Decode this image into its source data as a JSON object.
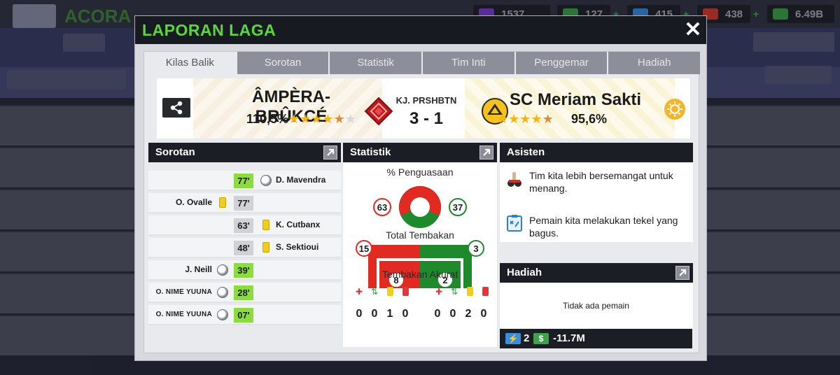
{
  "background": {
    "club_name": "ACORA",
    "resources": [
      {
        "name": "tokens",
        "value": "1537"
      },
      {
        "name": "cash-small",
        "value": "127"
      },
      {
        "name": "energy",
        "value": "415"
      },
      {
        "name": "medical",
        "value": "438"
      },
      {
        "name": "money",
        "value": "6.49B"
      }
    ]
  },
  "modal": {
    "title": "LAPORAN LAGA",
    "close_label": "✕"
  },
  "tabs": [
    "Kilas Balik",
    "Sorotan",
    "Statistik",
    "Tim Inti",
    "Penggemar",
    "Hadiah"
  ],
  "match": {
    "home": {
      "name": "ÂMPÈRA-BRÛKCÉ",
      "rating": "110,5%"
    },
    "away": {
      "name": "SC Meriam Sakti",
      "rating": "95,6%"
    },
    "competition": "KJ. PRSHBTN",
    "score": "3 - 1"
  },
  "highlights": {
    "title": "Sorotan",
    "events": [
      {
        "minute": "77'",
        "type": "goal",
        "side": "right",
        "player": "D. Mavendra"
      },
      {
        "minute": "77'",
        "type": "card",
        "side": "left",
        "player": "O. Ovalle"
      },
      {
        "minute": "63'",
        "type": "card",
        "side": "right",
        "player": "K. Cutbanx"
      },
      {
        "minute": "48'",
        "type": "card",
        "side": "right",
        "player": "S. Sektioui"
      },
      {
        "minute": "39'",
        "type": "goal",
        "side": "left",
        "player": "J. Neill"
      },
      {
        "minute": "28'",
        "type": "goal",
        "side": "left",
        "player": "O. NIME YUUNA"
      },
      {
        "minute": "07'",
        "type": "goal",
        "side": "left",
        "player": "O. NIME YUUNA"
      }
    ]
  },
  "stats": {
    "title": "Statistik",
    "possession_label": "% Penguasaan",
    "possession_home": 63,
    "possession_away": 37,
    "shots_label": "Total Tembakan",
    "shots_home": 15,
    "shots_away": 3,
    "on_target_label": "Tembakan Akurat",
    "on_target_home": 8,
    "on_target_away": 2,
    "discipline_icons": [
      "injury-icon",
      "substitution-icon",
      "yellow-card-icon",
      "red-card-icon"
    ],
    "discipline_home": [
      "0",
      "0",
      "1",
      "0"
    ],
    "discipline_away": [
      "0",
      "0",
      "2",
      "0"
    ],
    "colors": {
      "home": "#e02a22",
      "away": "#1e8a2b"
    }
  },
  "assistant": {
    "title": "Asisten",
    "items": [
      {
        "icon": "motivation-icon",
        "text": "Tim kita lebih bersemangat untuk menang."
      },
      {
        "icon": "tactics-board-icon",
        "text": "Pemain kita melakukan tekel yang bagus."
      }
    ]
  },
  "rewards": {
    "title": "Hadiah",
    "empty_text": "Tidak ada pemain",
    "energy": "2",
    "money": "-11.7M"
  }
}
